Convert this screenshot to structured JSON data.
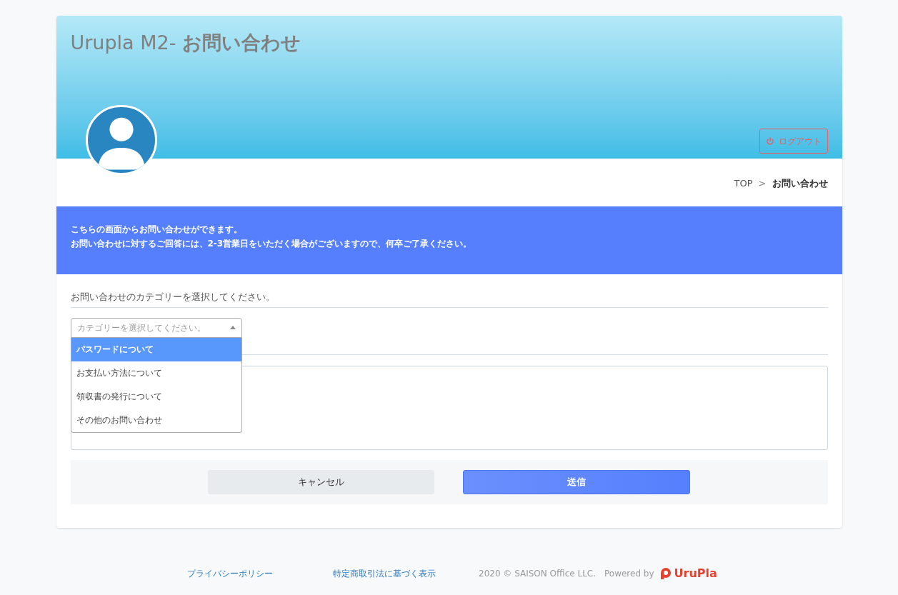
{
  "header": {
    "title": "Urupla M2- **お問い合わせ**",
    "logout": "ログアウト"
  },
  "breadcrumb": [
    {
      "label": "TOP",
      "current": false
    },
    {
      "label": "お問い合わせ",
      "current": true
    }
  ],
  "breadcrumb_separator": ">",
  "notice": [
    "こちらの画面からお問い合わせができます。",
    "お問い合わせに対するご回答には、2-3営業日をいただく場合がございますので、何卒ご了承ください。"
  ],
  "category": {
    "label": "お問い合わせのカテゴリーを選択してください。",
    "placeholder": "カテゴリーを選択してください。",
    "expanded": true,
    "options": [
      {
        "label": "パスワードについて",
        "selected": true
      },
      {
        "label": "お支払い方法について",
        "selected": false
      },
      {
        "label": "領収書の発行について",
        "selected": false
      },
      {
        "label": "その他のお問い合わせ",
        "selected": false
      }
    ]
  },
  "buttons": {
    "cancel": "キャンセル",
    "submit": "送信"
  },
  "footer": {
    "links": [
      "プライバシーポリシー",
      "特定商取引法に基づく表示"
    ],
    "copyright": "2020 © SAISON Office LLC.",
    "powered_by": "Powered by",
    "logo": "UruPla"
  }
}
